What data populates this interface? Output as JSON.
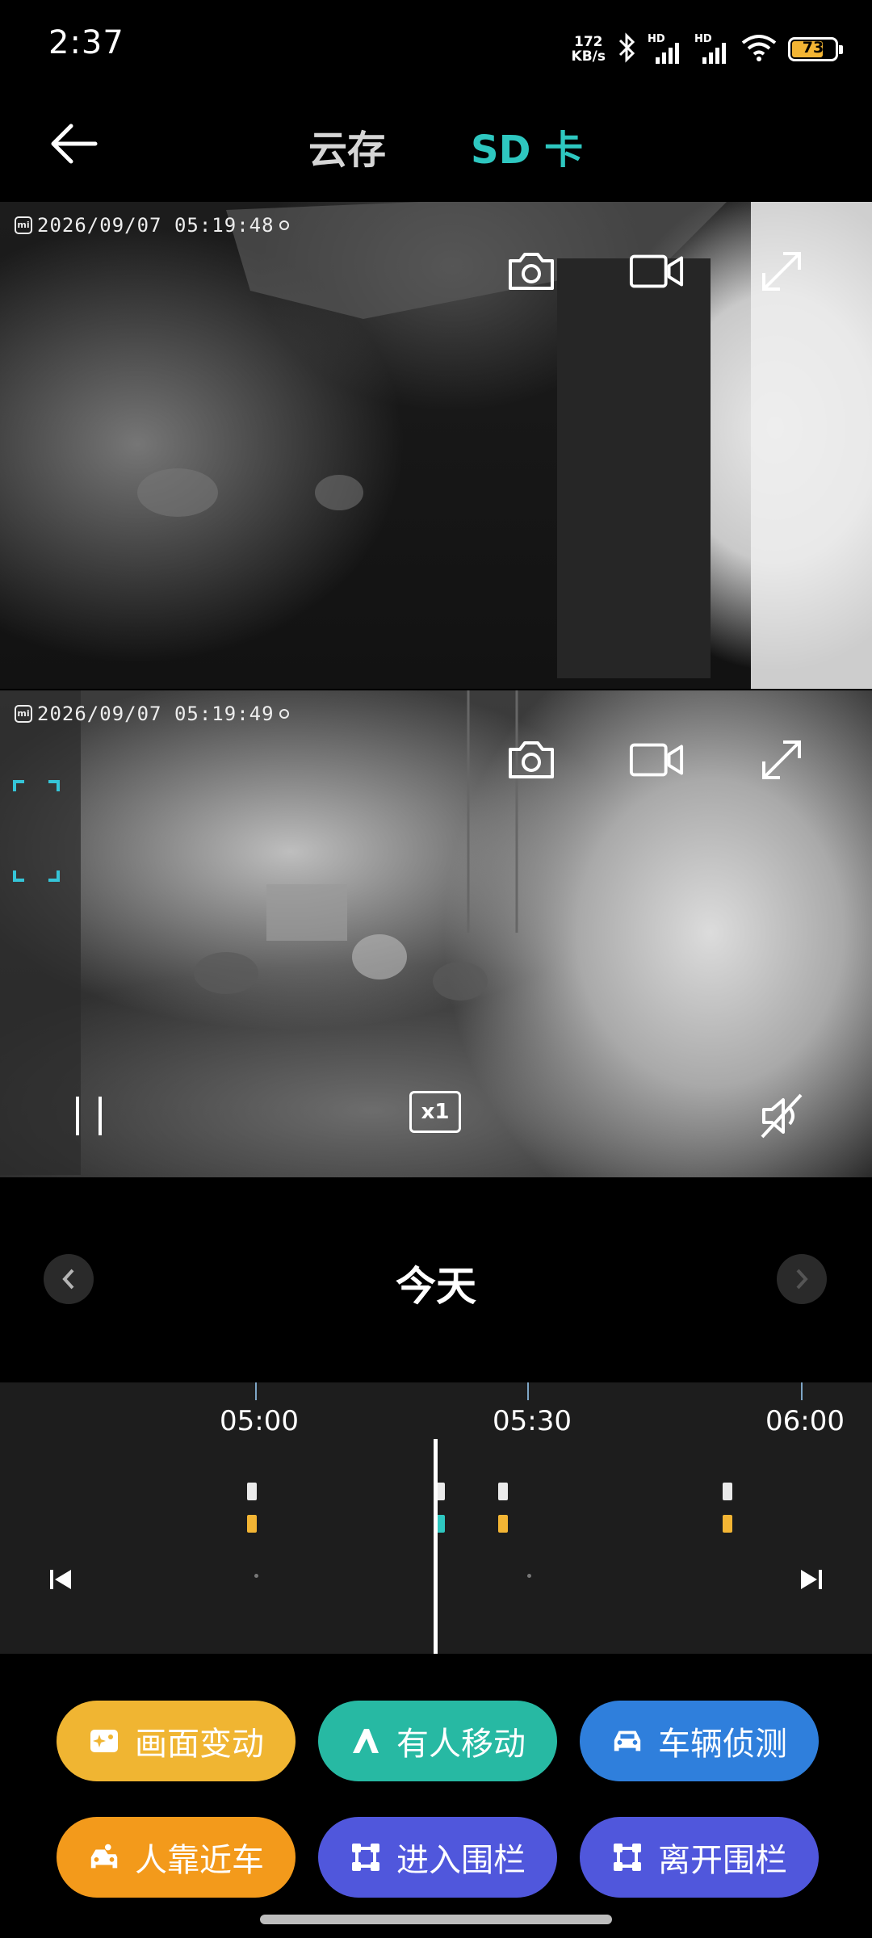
{
  "status_bar": {
    "time": "2:37",
    "net_speed_value": "172",
    "net_speed_unit": "KB/s",
    "signal_1_label": "HD",
    "signal_2_label": "HD",
    "battery": "73",
    "battery_level": 0.73
  },
  "header": {
    "tabs": [
      {
        "label": "云存",
        "selected": false
      },
      {
        "label": "SD 卡",
        "selected": true
      }
    ]
  },
  "videos": [
    {
      "timestamp": "2026/09/07  05:19:48",
      "logo": "mi"
    },
    {
      "timestamp": "2026/09/07  05:19:49",
      "logo": "mi",
      "speed": "x1"
    }
  ],
  "date_nav": {
    "label": "今天"
  },
  "timeline": {
    "ticks": [
      "05:00",
      "05:30",
      "06:00"
    ]
  },
  "filters": [
    {
      "label": "画面变动",
      "icon": "image-sparkle-icon",
      "color": "#f0b532"
    },
    {
      "label": "有人移动",
      "icon": "person-walking-icon",
      "color": "#27b9a3"
    },
    {
      "label": "车辆侦测",
      "icon": "car-icon",
      "color": "#2f7fdc"
    },
    {
      "label": "人靠近车",
      "icon": "person-car-icon",
      "color": "#f39a1b"
    },
    {
      "label": "进入围栏",
      "icon": "fence-icon",
      "color": "#5057dc"
    },
    {
      "label": "离开围栏",
      "icon": "fence-icon",
      "color": "#5057dc"
    }
  ],
  "colors": {
    "accent": "#2ec7c0",
    "background": "#000000",
    "timeline_bg": "#1d1d1d"
  }
}
